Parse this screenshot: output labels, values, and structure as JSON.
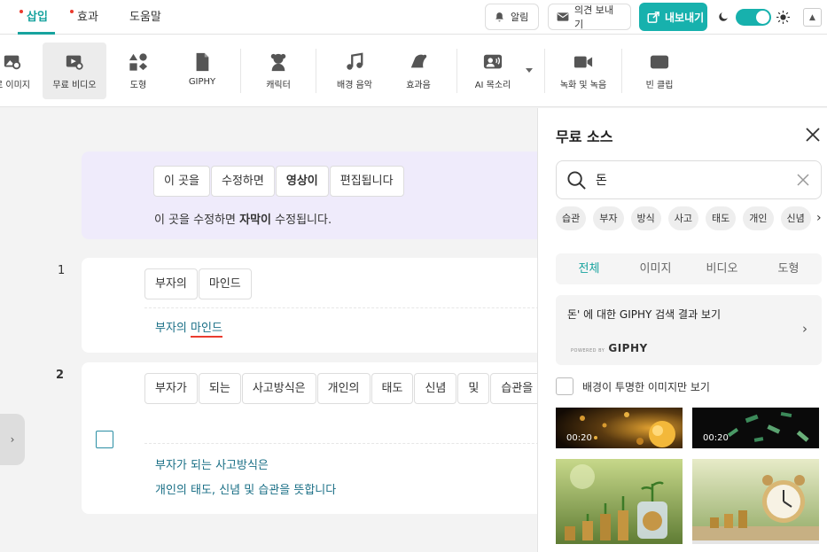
{
  "header": {
    "tabs": [
      {
        "label": "삽입",
        "active": true
      },
      {
        "label": "효과",
        "active": false
      },
      {
        "label": "도움말",
        "active": false
      }
    ],
    "notifications_label": "알림",
    "feedback_label": "의견 보내기",
    "export_label": "내보내기",
    "theme_dark": true,
    "accent_color": "#17b1ad",
    "notification_dot_color": "#ea3b2e"
  },
  "toolbar": {
    "items": [
      {
        "label": "로 이미지",
        "icon": "image-search-icon",
        "selected": false
      },
      {
        "label": "무료 비디오",
        "icon": "video-search-icon",
        "selected": true
      },
      {
        "label": "도형",
        "icon": "shapes-icon",
        "selected": false
      },
      {
        "label": "GIPHY",
        "icon": "file-icon",
        "selected": false
      },
      {
        "label": "캐릭터",
        "icon": "character-icon",
        "selected": false
      },
      {
        "label": "배경 음악",
        "icon": "music-note-icon",
        "selected": false
      },
      {
        "label": "효과음",
        "icon": "sound-effect-icon",
        "selected": false
      },
      {
        "label": "AI 목소리",
        "icon": "ai-voice-icon",
        "selected": false
      },
      {
        "label": "녹화 및 녹음",
        "icon": "camera-icon",
        "selected": false
      },
      {
        "label": "빈 클립",
        "icon": "blank-clip-icon",
        "selected": false
      }
    ]
  },
  "editor": {
    "hint": {
      "chips": [
        "이 곳을",
        "수정하면",
        "영상이",
        "편집됩니다"
      ],
      "bold_chip": "영상이",
      "caption_before": "이 곳을 수정하면",
      "caption_bold": "자막이",
      "caption_after": "수정됩니다."
    },
    "rows": [
      {
        "number": "1",
        "chips": [
          "부자의",
          "마인드"
        ],
        "subtitle_lines": [
          "부자의 마인드"
        ],
        "subtitle_word1": "부자의",
        "subtitle_word2": "마인드"
      },
      {
        "number": "2",
        "chips": [
          "부자가",
          "되는",
          "사고방식은",
          "개인의",
          "태도",
          "신념",
          "및",
          "습관을"
        ],
        "subtitle_lines": [
          "부자가 되는 사고방식은",
          "개인의 태도, 신념 및 습관을 뜻합니다"
        ]
      }
    ]
  },
  "panel": {
    "title": "무료 소스",
    "search_value": "돈",
    "tags": [
      "습관",
      "부자",
      "방식",
      "사고",
      "태도",
      "개인",
      "신념"
    ],
    "filter_tabs": [
      {
        "label": "전체",
        "active": true
      },
      {
        "label": "이미지",
        "active": false
      },
      {
        "label": "비디오",
        "active": false
      },
      {
        "label": "도형",
        "active": false
      }
    ],
    "giphy_result_text": "돈' 에 대한 GIPHY 검색 결과 보기",
    "giphy_powered": "POWERED BY",
    "giphy_brand": "GIPHY",
    "transparent_only_label": "배경이 투명한 이미지만 보기",
    "thumbnails": [
      {
        "duration": "00:20"
      },
      {
        "duration": "00:20"
      },
      {
        "duration": ""
      },
      {
        "duration": ""
      }
    ]
  }
}
